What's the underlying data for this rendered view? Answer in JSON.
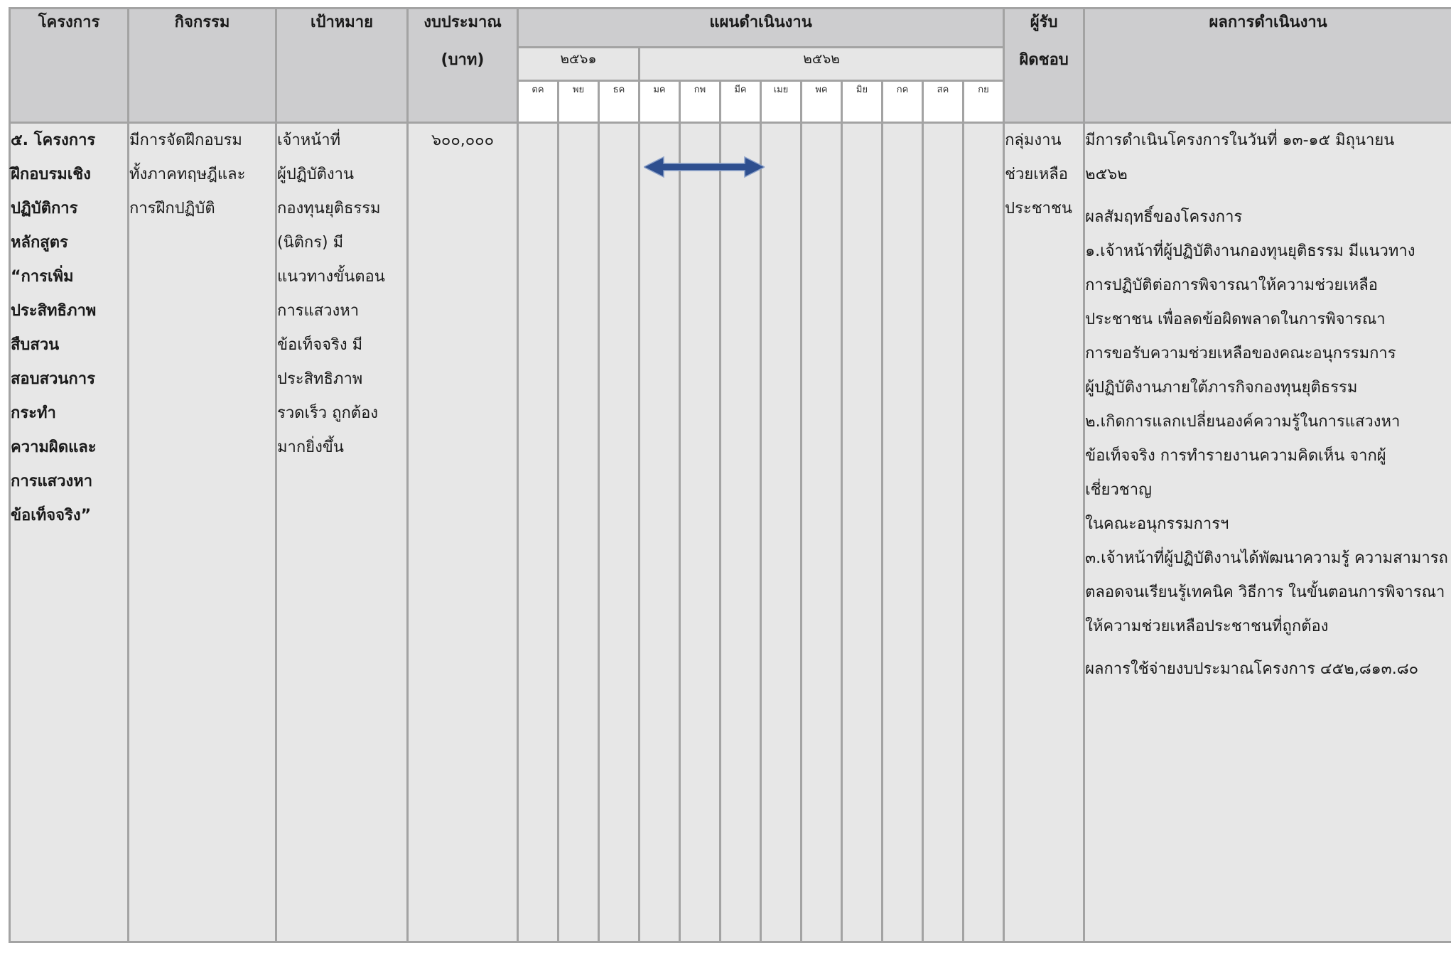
{
  "headers": {
    "project": "โครงการ",
    "activity": "กิจกรรม",
    "target": "เป้าหมาย",
    "budget_line1": "งบประมาณ",
    "budget_line2": "(บาท)",
    "plan": "แผนดำเนินงาน",
    "responsible_line1": "ผู้รับ",
    "responsible_line2": "ผิดชอบ",
    "result": "ผลการดำเนินงาน"
  },
  "years": [
    "๒๕๖๑",
    "๒๕๖๒"
  ],
  "months": [
    "ตค",
    "พย",
    "ธค",
    "มค",
    "กพ",
    "มีค",
    "เมย",
    "พค",
    "มิย",
    "กค",
    "สค",
    "กย"
  ],
  "timeline_bar": {
    "from_month": "มค",
    "to_month": "มีค",
    "color": "#2e4f8f"
  },
  "row": {
    "project_lines": [
      "๕. โครงการ",
      "ฝึกอบรมเชิง",
      "ปฏิบัติการ",
      "หลักสูตร",
      "“การเพิ่ม",
      "ประสิทธิภาพ",
      "สืบสวน",
      "สอบสวนการ",
      "กระทำ",
      "ความผิดและ",
      "การแสวงหา",
      "ข้อเท็จจริง”"
    ],
    "activity_lines": [
      "มีการจัดฝึกอบรม",
      "ทั้งภาคทฤษฎีและ",
      "การฝึกปฏิบัติ"
    ],
    "target_lines": [
      "เจ้าหน้าที่",
      "ผู้ปฏิบัติงาน",
      "กองทุนยุติธรรม",
      "(นิติกร) มี",
      "แนวทางขั้นตอน",
      "การแสวงหา",
      "ข้อเท็จจริง มี",
      "ประสิทธิภาพ",
      "รวดเร็ว ถูกต้อง",
      "มากยิ่งขึ้น"
    ],
    "budget": "๖๐๐,๐๐๐",
    "responsible_lines": [
      "กลุ่มงาน",
      "ช่วยเหลือ",
      "ประชาชน"
    ],
    "result": {
      "date_lines": [
        "มีการดำเนินโครงการในวันที่ ๑๓-๑๕ มิถุนายน",
        "๒๕๖๒"
      ],
      "outcome_title": "ผลสัมฤทธิ์ของโครงการ",
      "outcome_lines": [
        "๑.เจ้าหน้าที่ผู้ปฏิบัติงานกองทุนยุติธรรม มีแนวทาง",
        "การปฏิบัติต่อการพิจารณาให้ความช่วยเหลือ",
        "ประชาชน เพื่อลดข้อผิดพลาดในการพิจารณา",
        "การขอรับความช่วยเหลือของคณะอนุกรรมการ",
        "ผู้ปฏิบัติงานภายใต้ภารกิจกองทุนยุติธรรม",
        "๒.เกิดการแลกเปลี่ยนองค์ความรู้ในการแสวงหา",
        "ข้อเท็จจริง การทำรายงานความคิดเห็น จากผู้เชี่ยวชาญ",
        "ในคณะอนุกรรมการฯ",
        "๓.เจ้าหน้าที่ผู้ปฏิบัติงานได้พัฒนาความรู้ ความสามารถ",
        "ตลอดจนเรียนรู้เทคนิค วิธีการ ในขั้นตอนการพิจารณา",
        "ให้ความช่วยเหลือประชาชนที่ถูกต้อง"
      ],
      "budget_used": "ผลการใช้จ่ายงบประมาณโครงการ ๔๕๒,๘๑๓.๘๐"
    }
  }
}
